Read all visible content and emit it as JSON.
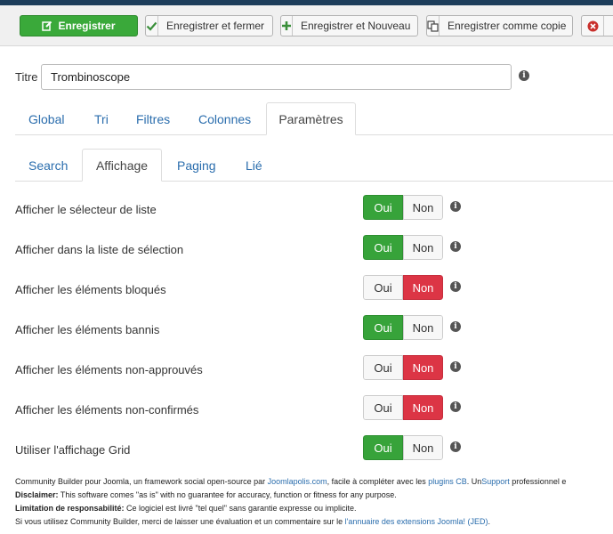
{
  "toolbar": {
    "save_label": "Enregistrer",
    "save_close_label": "Enregistrer et fermer",
    "save_new_label": "Enregistrer et Nouveau",
    "save_copy_label": "Enregistrer comme copie"
  },
  "form": {
    "title_label": "Titre",
    "title_value": "Trombinoscope"
  },
  "tabs": [
    "Global",
    "Tri",
    "Filtres",
    "Colonnes",
    "Paramètres"
  ],
  "subtabs": [
    "Search",
    "Affichage",
    "Paging",
    "Lié"
  ],
  "settings": [
    {
      "label": "Afficher le sélecteur de liste",
      "yes": "Oui",
      "no": "Non",
      "value": "Oui"
    },
    {
      "label": "Afficher dans la liste de sélection",
      "yes": "Oui",
      "no": "Non",
      "value": "Oui"
    },
    {
      "label": "Afficher les éléments bloqués",
      "yes": "Oui",
      "no": "Non",
      "value": "Non"
    },
    {
      "label": "Afficher les éléments bannis",
      "yes": "Oui",
      "no": "Non",
      "value": "Oui"
    },
    {
      "label": "Afficher les éléments non-approuvés",
      "yes": "Oui",
      "no": "Non",
      "value": "Non"
    },
    {
      "label": "Afficher les éléments non-confirmés",
      "yes": "Oui",
      "no": "Non",
      "value": "Non"
    },
    {
      "label": "Utiliser l'affichage Grid",
      "yes": "Oui",
      "no": "Non",
      "value": "Oui"
    }
  ],
  "footer": {
    "line1_a": "Community Builder pour Joomla, un framework social open-source par ",
    "line1_link1": "Joomlapolis.com",
    "line1_b": ", facile à compléter avec les ",
    "line1_link2": "plugins CB",
    "line1_c": ". Un",
    "line1_link3": "Support",
    "line1_d": " professionnel e",
    "line2_bold": "Disclaimer:",
    "line2_text": " This software comes \"as is\" with no guarantee for accuracy, function or fitness for any purpose.",
    "line3_bold": "Limitation de responsabilité:",
    "line3_text": " Ce logiciel est livré \"tel quel\" sans garantie expresse ou implicite.",
    "line4_text": "Si vous utilisez Community Builder, merci de laisser une évaluation et un commentaire sur le ",
    "line4_link": "l'annuaire des extensions Joomla! (JED)",
    "line4_end": "."
  },
  "colors": {
    "success": "#37a33a",
    "danger": "#dc3545",
    "link": "#2a6dad"
  },
  "icons": {
    "save": "edit-icon",
    "save_close": "check-icon",
    "save_new": "plus-icon",
    "save_copy": "copy-icon",
    "cancel": "cancel-icon",
    "info": "info-icon"
  }
}
